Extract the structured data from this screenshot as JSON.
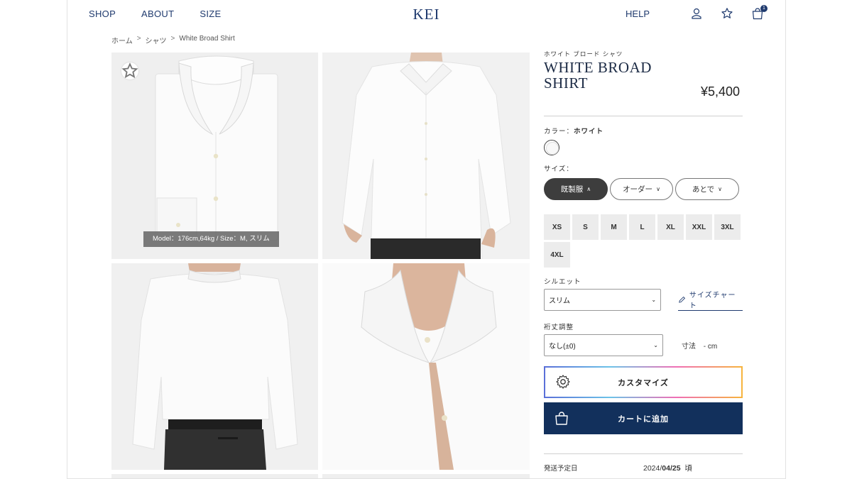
{
  "header": {
    "nav": [
      "SHOP",
      "ABOUT",
      "SIZE"
    ],
    "logo": "KEI",
    "help": "HELP",
    "cart_count": "1",
    "icons": [
      "user-icon",
      "star-icon",
      "bag-icon"
    ]
  },
  "breadcrumb": {
    "items": [
      "ホーム",
      "シャツ",
      "White Broad Shirt"
    ],
    "separator": ">"
  },
  "gallery": {
    "model_caption": "Model：176cm,64kg / Size：M, スリム"
  },
  "product": {
    "kana": "ホワイト ブロード シャツ",
    "title_line1": "WHITE BROAD",
    "title_line2": "SHIRT",
    "price": "¥5,400",
    "color_label": "カラー：",
    "color_value": "ホワイト",
    "size_label": "サイズ：",
    "size_tabs": [
      {
        "label": "既製服",
        "chevron": "∧"
      },
      {
        "label": "オーダー",
        "chevron": "∨"
      },
      {
        "label": "あとで",
        "chevron": "∨"
      }
    ],
    "sizes": [
      "XS",
      "S",
      "M",
      "L",
      "XL",
      "XXL",
      "3XL",
      "4XL"
    ],
    "silhouette_label": "シルエット",
    "silhouette_value": "スリム",
    "size_chart_link": "サイズチャート",
    "length_label": "裄丈調整",
    "length_value": "なし(±0)",
    "measure_label": "寸法",
    "measure_value": "- cm",
    "customize_label": "カスタマイズ",
    "add_to_cart_label": "カートに追加",
    "ship_label": "発送予定日",
    "ship_year": "2024/",
    "ship_md": "04/25",
    "ship_suffix": "頃"
  },
  "colors": {
    "brand_navy": "#12305c",
    "active_tab": "#3d3d3d"
  }
}
